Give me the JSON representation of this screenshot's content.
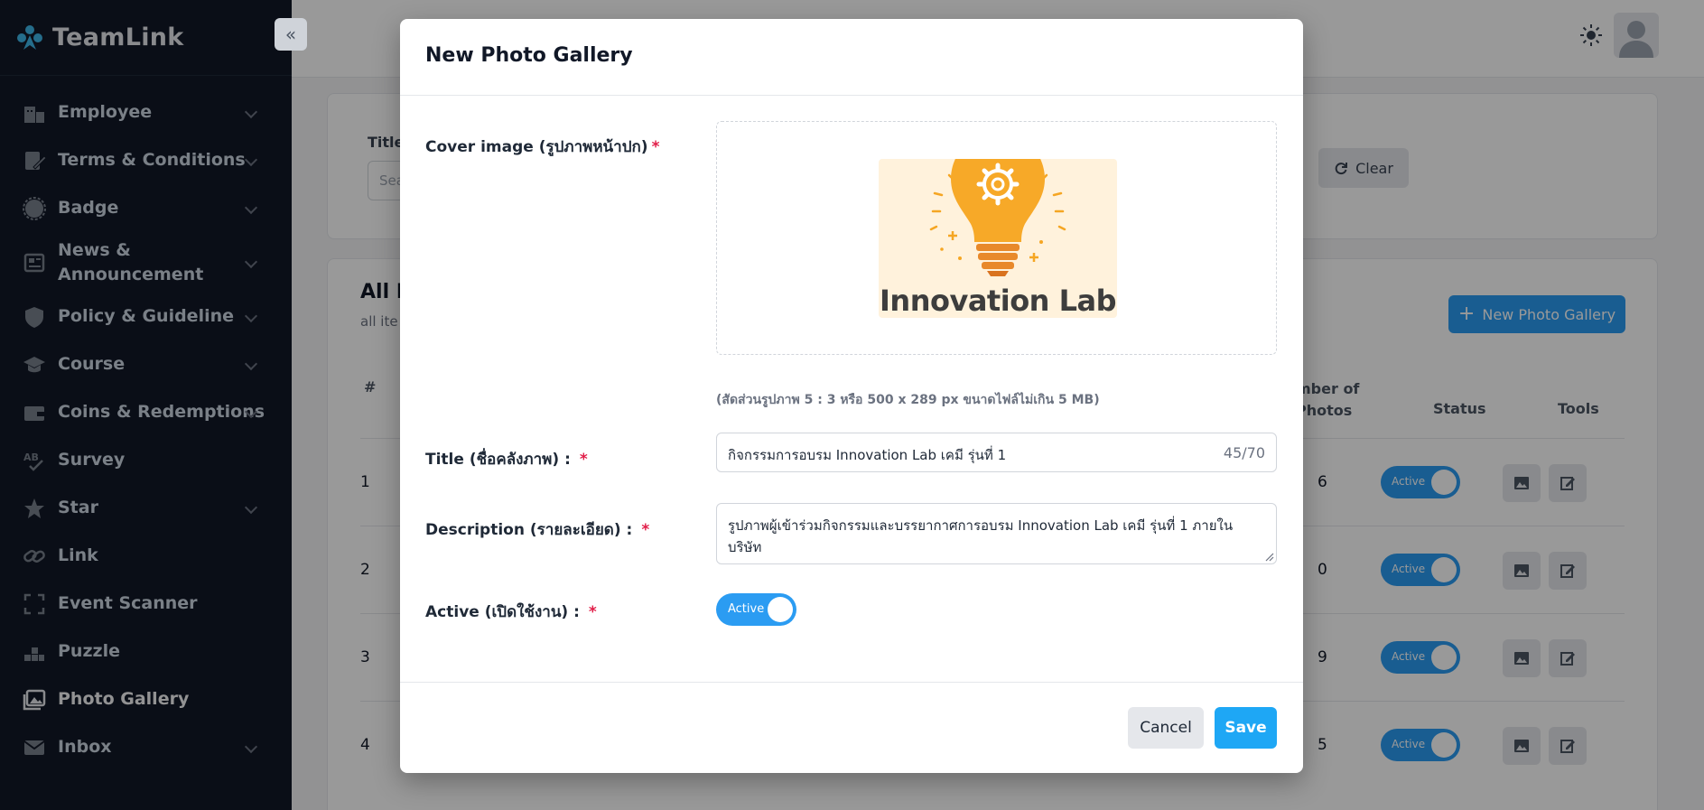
{
  "app": {
    "name": "TeamLink"
  },
  "sidebar": {
    "items": [
      {
        "label": "Employee",
        "icon": "employee-icon",
        "has_children": true
      },
      {
        "label": "Terms & Conditions",
        "icon": "contract-icon",
        "has_children": true
      },
      {
        "label": "Badge",
        "icon": "badge-icon",
        "has_children": true
      },
      {
        "label": "News & Announcement",
        "icon": "news-icon",
        "has_children": true
      },
      {
        "label": "Policy & Guideline",
        "icon": "shield-icon",
        "has_children": true
      },
      {
        "label": "Course",
        "icon": "graduation-cap-icon",
        "has_children": true
      },
      {
        "label": "Coins & Redemptions",
        "icon": "wallet-icon",
        "has_children": true
      },
      {
        "label": "Survey",
        "icon": "survey-icon",
        "has_children": false
      },
      {
        "label": "Star",
        "icon": "star-icon",
        "has_children": true
      },
      {
        "label": "Link",
        "icon": "link-icon",
        "has_children": false
      },
      {
        "label": "Event Scanner",
        "icon": "scanner-icon",
        "has_children": false
      },
      {
        "label": "Puzzle",
        "icon": "puzzle-icon",
        "has_children": false
      },
      {
        "label": "Photo Gallery",
        "icon": "gallery-icon",
        "has_children": false,
        "active": true
      },
      {
        "label": "Inbox",
        "icon": "mail-icon",
        "has_children": true
      }
    ]
  },
  "background": {
    "filter": {
      "title_label": "Title",
      "search_placeholder": "Sea",
      "clear_label": "Clear"
    },
    "list": {
      "title": "All P",
      "subtitle": "all ite",
      "new_button_label": "New Photo Gallery",
      "columns": {
        "index": "#",
        "photos": "Number of Photos",
        "status": "Status",
        "tools": "Tools"
      },
      "photos_header_visible": "mber of\nPhotos",
      "rows": [
        {
          "index": "1",
          "photos": "6",
          "status": "Active"
        },
        {
          "index": "2",
          "photos": "0",
          "status": "Active"
        },
        {
          "index": "3",
          "photos": "9",
          "status": "Active"
        },
        {
          "index": "4",
          "photos": "5",
          "status": "Active"
        }
      ]
    }
  },
  "modal": {
    "title": "New Photo Gallery",
    "cover_label": "Cover image (รูปภาพหน้าปก)",
    "cover_image_text": "Innovation Lab",
    "cover_hint": "(สัดส่วนรูปภาพ 5 : 3 หรือ 500 x 289 px ขนาดไฟล์ไม่เกิน 5 MB)",
    "title_label": "Title (ชื่อคลังภาพ) :",
    "title_value": "กิจกรรมการอบรม Innovation Lab เคมี รุ่นที่ 1",
    "title_counter": "45/70",
    "description_label": "Description (รายละเอียด) :",
    "description_value": "รูปภาพผู้เข้าร่วมกิจกรรมและบรรยากาศการอบรม Innovation Lab เคมี รุ่นที่ 1 ภายในบริษัท",
    "active_label": "Active (เปิดใช้งาน) :",
    "active_toggle_label": "Active",
    "required_mark": "*",
    "cancel_label": "Cancel",
    "save_label": "Save"
  },
  "colors": {
    "primary": "#1ea7f5",
    "sidebar_bg": "#111827",
    "required": "#e11d48"
  }
}
